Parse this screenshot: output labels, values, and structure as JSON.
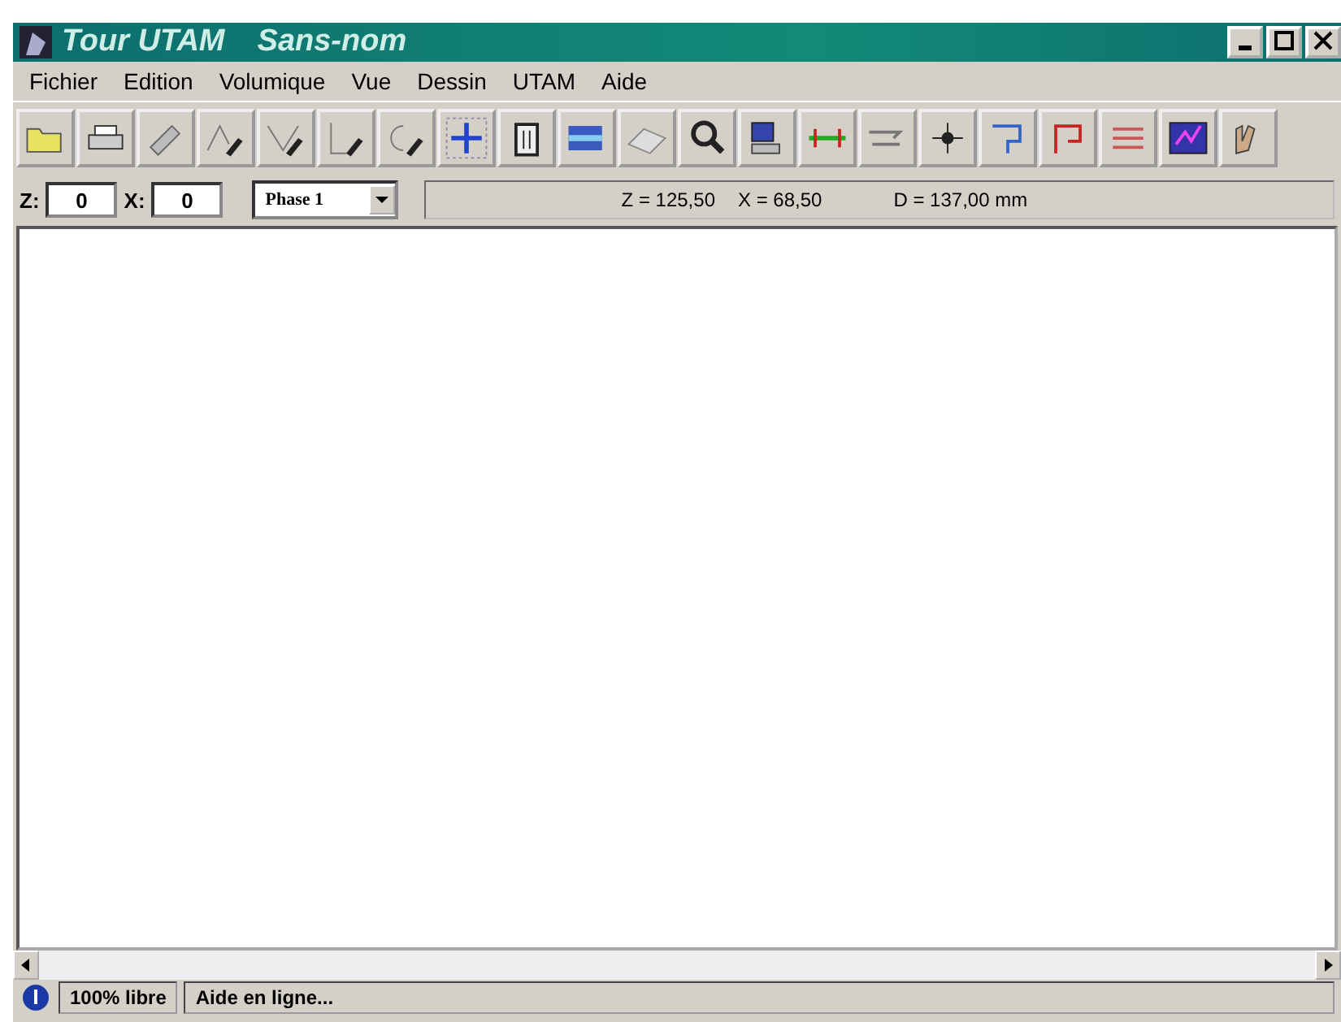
{
  "window": {
    "title": "Tour UTAM",
    "document": "Sans-nom"
  },
  "menu": [
    "Fichier",
    "Edition",
    "Volumique",
    "Vue",
    "Dessin",
    "UTAM",
    "Aide"
  ],
  "fields": [
    {
      "label": "Z:",
      "value": "0"
    },
    {
      "label": "X:",
      "value": "0"
    }
  ],
  "phase": {
    "value": "Phase 1"
  },
  "readouts": [
    "Z = 125,50",
    "X = 68,50",
    "D = 137,00 mm"
  ],
  "status_bar": {
    "memory": "100% libre",
    "message": "Aide en ligne..."
  }
}
